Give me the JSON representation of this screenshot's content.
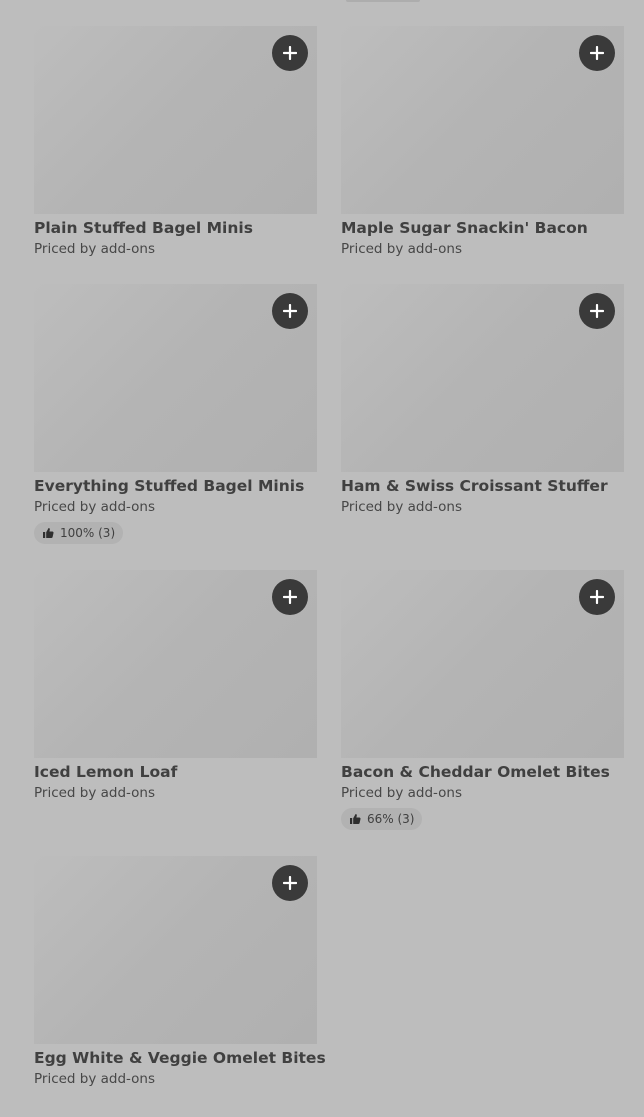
{
  "menu_items": [
    {
      "title": "Plain Stuffed Bagel Minis",
      "price": "Priced by add-ons"
    },
    {
      "title": "Maple Sugar Snackin' Bacon",
      "price": "Priced by add-ons"
    },
    {
      "title": "Everything Stuffed Bagel Minis",
      "price": "Priced by add-ons",
      "rating": "100% (3)"
    },
    {
      "title": "Ham & Swiss Croissant Stuffer",
      "price": "Priced by add-ons"
    },
    {
      "title": "Iced Lemon Loaf",
      "price": "Priced by add-ons"
    },
    {
      "title": "Bacon & Cheddar Omelet Bites",
      "price": "Priced by add-ons",
      "rating": "66% (3)"
    },
    {
      "title": "Egg White & Veggie Omelet Bites",
      "price": "Priced by add-ons"
    }
  ]
}
